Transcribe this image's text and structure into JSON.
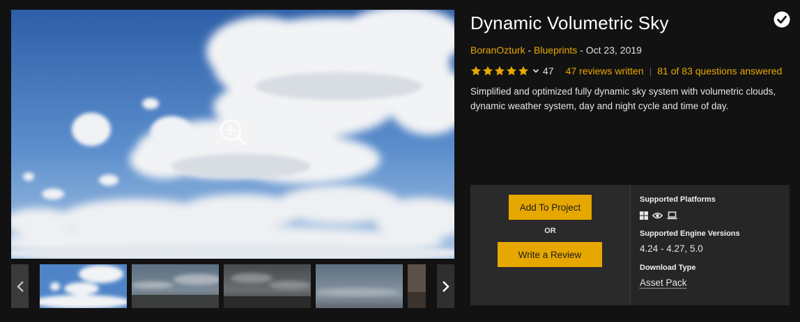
{
  "product": {
    "title": "Dynamic Volumetric Sky",
    "seller": "BoranOzturk",
    "byline_sep": "-",
    "category": "Blueprints",
    "date_sep": "-",
    "date": "Oct 23, 2019",
    "description": "Simplified and optimized fully dynamic sky system with volumetric clouds, dynamic weather system, day and night cycle and time of day.",
    "owned_icon": "check-circle-icon"
  },
  "rating": {
    "stars": 5,
    "stars_max": 5,
    "count": "47",
    "reviews_link": "47 reviews written",
    "questions_link": "81 of 83 questions answered",
    "separator": "|"
  },
  "gallery": {
    "zoom_icon": "magnifier-plus-icon",
    "prev_icon": "chevron-left-icon",
    "next_icon": "chevron-right-icon",
    "thumbnail_count": 5
  },
  "purchase": {
    "add_button": "Add To Project",
    "or_label": "OR",
    "review_button": "Write a Review"
  },
  "specs": {
    "platforms_label": "Supported Platforms",
    "platform_icons": [
      "windows-icon",
      "eye-icon",
      "laptop-icon"
    ],
    "engine_label": "Supported Engine Versions",
    "engine_value": "4.24 - 4.27, 5.0",
    "download_label": "Download Type",
    "download_value": "Asset Pack"
  },
  "colors": {
    "background": "#121212",
    "accent": "#e6a800",
    "link": "#e8a900",
    "panel": "#262626"
  }
}
